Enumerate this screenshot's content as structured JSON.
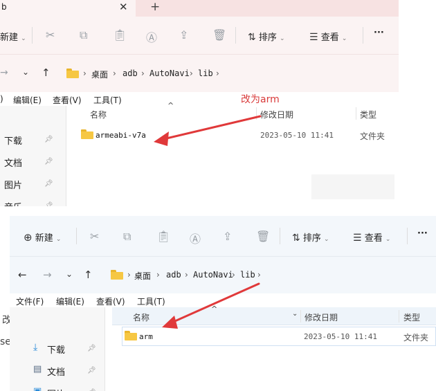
{
  "annotation": {
    "text": "改为arm",
    "color": "#d93a3a"
  },
  "top_window": {
    "tab": {
      "title": "b",
      "close": "✕",
      "new": "+"
    },
    "toolbar": {
      "new_label": "新建",
      "sort_label": "排序",
      "view_label": "查看",
      "more": "···"
    },
    "breadcrumb": [
      "桌面",
      "adb",
      "AutoNavi",
      "lib"
    ],
    "menu": [
      "编辑(E)",
      "查看(V)",
      "工具(T)"
    ],
    "menu_fragment": ")",
    "nav": [
      "下载",
      "文档",
      "图片",
      "音乐"
    ],
    "columns": {
      "name": "名称",
      "modified": "修改日期",
      "type": "类型"
    },
    "rows": [
      {
        "name": "armeabi-v7a",
        "modified": "2023-05-10 11:41",
        "type": "文件夹"
      }
    ]
  },
  "bottom_window": {
    "toolbar": {
      "new_label": "新建",
      "sort_label": "排序",
      "view_label": "查看",
      "more": "···"
    },
    "breadcrumb": [
      "桌面",
      "adb",
      "AutoNavi",
      "lib"
    ],
    "menu": [
      "文件(F)",
      "编辑(E)",
      "查看(V)",
      "工具(T)"
    ],
    "nav": [
      "下载",
      "文档",
      "图片"
    ],
    "columns": {
      "name": "名称",
      "modified": "修改日期",
      "type": "类型"
    },
    "rows": [
      {
        "name": "arm",
        "modified": "2023-05-10 11:41",
        "type": "文件夹"
      }
    ]
  },
  "edge_fragments": [
    "改",
    "se"
  ],
  "icons": {
    "cut": "scissors-icon",
    "copy": "copy-icon",
    "paste": "paste-icon",
    "rename": "rename-icon",
    "share": "share-icon",
    "delete": "trash-icon",
    "sort": "sort-icon",
    "view": "view-icon",
    "back": "back-arrow-icon",
    "forward": "forward-arrow-icon",
    "up": "up-arrow-icon"
  }
}
